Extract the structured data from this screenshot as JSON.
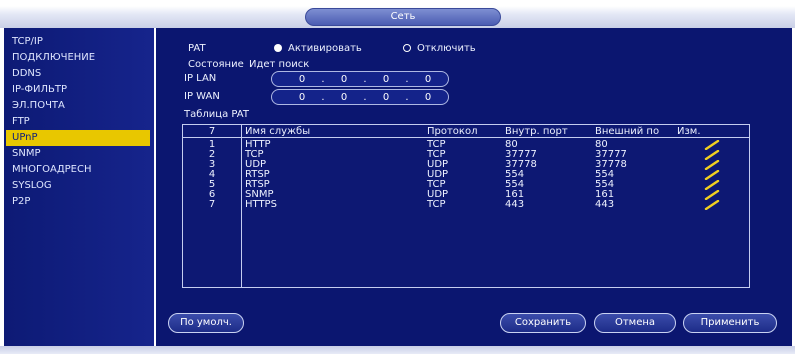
{
  "window": {
    "title": "Сеть"
  },
  "sidebar": {
    "items": [
      {
        "label": "TCP/IP",
        "active": false
      },
      {
        "label": "ПОДКЛЮЧЕНИЕ",
        "active": false
      },
      {
        "label": "DDNS",
        "active": false
      },
      {
        "label": "IP-ФИЛЬТР",
        "active": false
      },
      {
        "label": "ЭЛ.ПОЧТА",
        "active": false
      },
      {
        "label": "FTP",
        "active": false
      },
      {
        "label": "UPnP",
        "active": true
      },
      {
        "label": "SNMP",
        "active": false
      },
      {
        "label": "МНОГОАДРЕСН",
        "active": false
      },
      {
        "label": "SYSLOG",
        "active": false
      },
      {
        "label": "P2P",
        "active": false
      }
    ]
  },
  "form": {
    "pat_label": "PAT",
    "pat_options": {
      "enable": "Активировать",
      "disable": "Отключить",
      "selected": "enable"
    },
    "status_label": "Состояние",
    "status_value": "Идет поиск",
    "ip_lan": {
      "label": "IP LAN",
      "octets": [
        "0",
        "0",
        "0",
        "0"
      ]
    },
    "ip_wan": {
      "label": "IP WAN",
      "octets": [
        "0",
        "0",
        "0",
        "0"
      ]
    },
    "table_label": "Таблица PAT"
  },
  "table": {
    "count": "7",
    "columns": [
      "Имя службы",
      "Протокол",
      "Внутр. порт",
      "Внешний по",
      "Изм."
    ],
    "rows": [
      {
        "num": "1",
        "service": "HTTP",
        "protocol": "TCP",
        "internal": "80",
        "external": "80"
      },
      {
        "num": "2",
        "service": "TCP",
        "protocol": "TCP",
        "internal": "37777",
        "external": "37777"
      },
      {
        "num": "3",
        "service": "UDP",
        "protocol": "UDP",
        "internal": "37778",
        "external": "37778"
      },
      {
        "num": "4",
        "service": "RTSP",
        "protocol": "UDP",
        "internal": "554",
        "external": "554"
      },
      {
        "num": "5",
        "service": "RTSP",
        "protocol": "TCP",
        "internal": "554",
        "external": "554"
      },
      {
        "num": "6",
        "service": "SNMP",
        "protocol": "UDP",
        "internal": "161",
        "external": "161"
      },
      {
        "num": "7",
        "service": "HTTPS",
        "protocol": "TCP",
        "internal": "443",
        "external": "443"
      }
    ],
    "edit_icon": "pencil-icon"
  },
  "buttons": {
    "default": "По умолч.",
    "save": "Сохранить",
    "cancel": "Отмена",
    "apply": "Применить"
  },
  "colors": {
    "panel": "#0b1670",
    "sidebar": "#16248c",
    "active_item": "#e8c700",
    "edit_icon": "#f0d020"
  }
}
